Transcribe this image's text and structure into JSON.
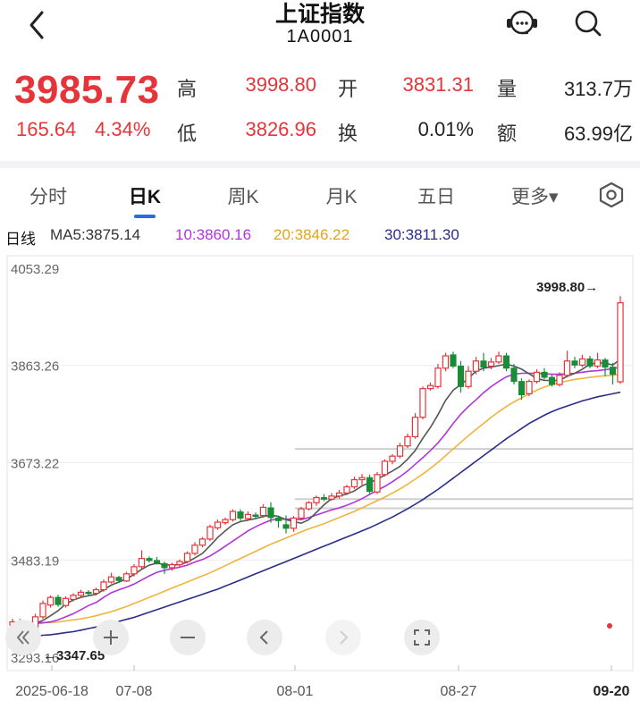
{
  "header": {
    "title": "上证指数",
    "code": "1A0001",
    "back_icon": "chevron-left-icon",
    "support_icon": "customer-service-icon",
    "search_icon": "search-icon"
  },
  "quote": {
    "price": "3985.73",
    "change": "165.64",
    "change_pct": "4.34%",
    "high_label": "高",
    "high": "3998.80",
    "low_label": "低",
    "low": "3826.96",
    "open_label": "开",
    "open": "3831.31",
    "turnover_label": "换",
    "turnover": "0.01%",
    "volume_label": "量",
    "volume": "313.7万",
    "amount_label": "额",
    "amount": "63.99亿"
  },
  "tabs": {
    "items": [
      "分时",
      "日K",
      "周K",
      "月K",
      "五日"
    ],
    "active": "日K",
    "more": "更多▾",
    "settings_icon": "gear-icon"
  },
  "ma": {
    "period": "日线",
    "ma5": "MA5:3875.14",
    "ma10": "10:3860.16",
    "ma20": "20:3846.22",
    "ma30": "30:3811.30"
  },
  "colors": {
    "up": "#e5343a",
    "down": "#1a8c38",
    "ma5": "#555555",
    "ma10": "#b035d8",
    "ma20": "#f0b43c",
    "ma30": "#2a2d8a"
  },
  "chart_data": {
    "type": "candlestick",
    "y_ticks": [
      "4053.29",
      "3863.26",
      "3673.22",
      "3483.19",
      "3293.16"
    ],
    "ylim": [
      3293.16,
      4053.29
    ],
    "x_ticks": [
      "2025-06-18",
      "07-08",
      "08-01",
      "08-27",
      "09-20"
    ],
    "max_label": "3998.80→",
    "min_label": "←3347.65",
    "high_value": 3998.8,
    "low_value": 3347.65,
    "candles": [
      [
        3356,
        3362,
        3348,
        3368
      ],
      [
        3362,
        3355,
        3349,
        3368
      ],
      [
        3359,
        3352,
        3347.65,
        3364
      ],
      [
        3350,
        3372,
        3346,
        3378
      ],
      [
        3372,
        3398,
        3368,
        3404
      ],
      [
        3395,
        3410,
        3390,
        3414
      ],
      [
        3410,
        3396,
        3392,
        3415
      ],
      [
        3394,
        3408,
        3390,
        3412
      ],
      [
        3406,
        3414,
        3402,
        3418
      ],
      [
        3414,
        3420,
        3409,
        3425
      ],
      [
        3420,
        3418,
        3412,
        3424
      ],
      [
        3418,
        3425,
        3414,
        3429
      ],
      [
        3425,
        3440,
        3421,
        3445
      ],
      [
        3440,
        3450,
        3437,
        3458
      ],
      [
        3449,
        3443,
        3438,
        3452
      ],
      [
        3442,
        3456,
        3440,
        3460
      ],
      [
        3456,
        3470,
        3451,
        3475
      ],
      [
        3470,
        3486,
        3466,
        3502
      ],
      [
        3486,
        3482,
        3478,
        3490
      ],
      [
        3482,
        3478,
        3474,
        3489
      ],
      [
        3476,
        3468,
        3456,
        3480
      ],
      [
        3468,
        3474,
        3462,
        3478
      ],
      [
        3474,
        3480,
        3469,
        3484
      ],
      [
        3480,
        3496,
        3476,
        3500
      ],
      [
        3496,
        3512,
        3492,
        3518
      ],
      [
        3512,
        3524,
        3508,
        3528
      ],
      [
        3524,
        3548,
        3520,
        3552
      ],
      [
        3546,
        3557,
        3542,
        3562
      ],
      [
        3556,
        3562,
        3552,
        3566
      ],
      [
        3562,
        3578,
        3558,
        3582
      ],
      [
        3577,
        3565,
        3560,
        3582
      ],
      [
        3564,
        3572,
        3560,
        3578
      ],
      [
        3571,
        3570,
        3565,
        3576
      ],
      [
        3570,
        3586,
        3566,
        3592
      ],
      [
        3585,
        3566,
        3556,
        3596
      ],
      [
        3565,
        3560,
        3546,
        3570
      ],
      [
        3552,
        3545,
        3535,
        3570
      ],
      [
        3545,
        3565,
        3538,
        3569
      ],
      [
        3565,
        3583,
        3561,
        3587
      ],
      [
        3583,
        3595,
        3580,
        3598
      ],
      [
        3595,
        3605,
        3589,
        3609
      ],
      [
        3605,
        3602,
        3598,
        3612
      ],
      [
        3602,
        3608,
        3599,
        3614
      ],
      [
        3608,
        3614,
        3603,
        3620
      ],
      [
        3614,
        3626,
        3610,
        3630
      ],
      [
        3626,
        3640,
        3622,
        3646
      ],
      [
        3640,
        3644,
        3630,
        3651
      ],
      [
        3644,
        3617,
        3612,
        3650
      ],
      [
        3616,
        3650,
        3612,
        3655
      ],
      [
        3650,
        3676,
        3646,
        3680
      ],
      [
        3676,
        3686,
        3670,
        3690
      ],
      [
        3686,
        3706,
        3682,
        3712
      ],
      [
        3706,
        3724,
        3702,
        3730
      ],
      [
        3724,
        3762,
        3720,
        3770
      ],
      [
        3762,
        3818,
        3758,
        3822
      ],
      [
        3818,
        3824,
        3814,
        3830
      ],
      [
        3822,
        3858,
        3818,
        3866
      ],
      [
        3858,
        3882,
        3852,
        3888
      ],
      [
        3884,
        3862,
        3858,
        3890
      ],
      [
        3862,
        3822,
        3810,
        3872
      ],
      [
        3822,
        3852,
        3818,
        3862
      ],
      [
        3852,
        3872,
        3846,
        3880
      ],
      [
        3872,
        3860,
        3852,
        3888
      ],
      [
        3862,
        3870,
        3856,
        3878
      ],
      [
        3870,
        3882,
        3866,
        3890
      ],
      [
        3882,
        3858,
        3852,
        3888
      ],
      [
        3858,
        3832,
        3826,
        3866
      ],
      [
        3832,
        3806,
        3796,
        3838
      ],
      [
        3808,
        3832,
        3803,
        3836
      ],
      [
        3832,
        3850,
        3828,
        3856
      ],
      [
        3850,
        3840,
        3836,
        3858
      ],
      [
        3840,
        3826,
        3822,
        3845
      ],
      [
        3826,
        3844,
        3822,
        3850
      ],
      [
        3844,
        3872,
        3840,
        3892
      ],
      [
        3872,
        3864,
        3858,
        3880
      ],
      [
        3864,
        3876,
        3860,
        3884
      ],
      [
        3876,
        3862,
        3858,
        3882
      ],
      [
        3862,
        3874,
        3858,
        3888
      ],
      [
        3874,
        3860,
        3842,
        3878
      ],
      [
        3860,
        3846,
        3826,
        3868
      ],
      [
        3831.31,
        3985.73,
        3826.96,
        3998.8
      ]
    ],
    "ma5": [
      3358,
      3358,
      3357,
      3359,
      3365,
      3374,
      3384,
      3397,
      3405,
      3410,
      3413,
      3416,
      3425,
      3434,
      3440,
      3446,
      3455,
      3465,
      3473,
      3477,
      3474,
      3473,
      3474,
      3479,
      3487,
      3496,
      3511,
      3527,
      3540,
      3552,
      3558,
      3561,
      3564,
      3568,
      3571,
      3568,
      3562,
      3558,
      3555,
      3562,
      3576,
      3591,
      3603,
      3608,
      3612,
      3618,
      3628,
      3634,
      3641,
      3649,
      3657,
      3666,
      3680,
      3697,
      3721,
      3742,
      3767,
      3795,
      3815,
      3826,
      3838,
      3852,
      3858,
      3860,
      3863,
      3866,
      3862,
      3856,
      3847,
      3838,
      3834,
      3834,
      3834,
      3842,
      3848,
      3856,
      3866,
      3868,
      3868,
      3864,
      3875
    ],
    "ma10": [
      3360,
      3360,
      3359,
      3359,
      3360,
      3362,
      3366,
      3372,
      3378,
      3386,
      3394,
      3400,
      3410,
      3419,
      3425,
      3430,
      3436,
      3444,
      3452,
      3459,
      3463,
      3466,
      3469,
      3473,
      3479,
      3484,
      3491,
      3500,
      3510,
      3520,
      3530,
      3540,
      3548,
      3555,
      3561,
      3563,
      3563,
      3563,
      3562,
      3566,
      3571,
      3576,
      3581,
      3585,
      3590,
      3596,
      3603,
      3611,
      3619,
      3627,
      3636,
      3646,
      3657,
      3670,
      3683,
      3697,
      3712,
      3730,
      3750,
      3768,
      3783,
      3796,
      3810,
      3822,
      3832,
      3841,
      3846,
      3848,
      3848,
      3848,
      3847,
      3846,
      3846,
      3847,
      3848,
      3850,
      3852,
      3853,
      3855,
      3857,
      3860
    ],
    "ma20": [
      3362,
      3362,
      3362,
      3361,
      3361,
      3361,
      3362,
      3364,
      3366,
      3368,
      3371,
      3374,
      3378,
      3382,
      3387,
      3392,
      3398,
      3404,
      3410,
      3416,
      3422,
      3428,
      3434,
      3440,
      3446,
      3452,
      3458,
      3465,
      3472,
      3479,
      3486,
      3493,
      3500,
      3507,
      3514,
      3520,
      3526,
      3532,
      3538,
      3544,
      3549,
      3554,
      3560,
      3566,
      3572,
      3578,
      3585,
      3592,
      3599,
      3606,
      3614,
      3622,
      3631,
      3641,
      3651,
      3662,
      3674,
      3687,
      3700,
      3713,
      3726,
      3738,
      3750,
      3762,
      3773,
      3783,
      3792,
      3800,
      3808,
      3815,
      3821,
      3826,
      3830,
      3833,
      3836,
      3838,
      3840,
      3842,
      3843,
      3844,
      3846
    ],
    "ma30": [
      3330,
      3331,
      3333,
      3334,
      3336,
      3337,
      3339,
      3341,
      3343,
      3346,
      3349,
      3352,
      3355,
      3359,
      3363,
      3367,
      3371,
      3376,
      3381,
      3386,
      3391,
      3396,
      3401,
      3406,
      3411,
      3416,
      3421,
      3426,
      3432,
      3438,
      3444,
      3450,
      3456,
      3462,
      3468,
      3474,
      3480,
      3486,
      3492,
      3498,
      3504,
      3510,
      3516,
      3522,
      3528,
      3534,
      3540,
      3546,
      3553,
      3560,
      3567,
      3575,
      3583,
      3592,
      3601,
      3611,
      3621,
      3632,
      3643,
      3654,
      3665,
      3676,
      3687,
      3698,
      3709,
      3720,
      3730,
      3740,
      3750,
      3758,
      3766,
      3773,
      3779,
      3784,
      3789,
      3794,
      3798,
      3802,
      3805,
      3808,
      3811
    ]
  },
  "controls": {
    "items": [
      "double-left-icon",
      "zoom-in-icon",
      "zoom-out-icon",
      "prev-icon",
      "next-icon",
      "fullscreen-icon"
    ]
  }
}
